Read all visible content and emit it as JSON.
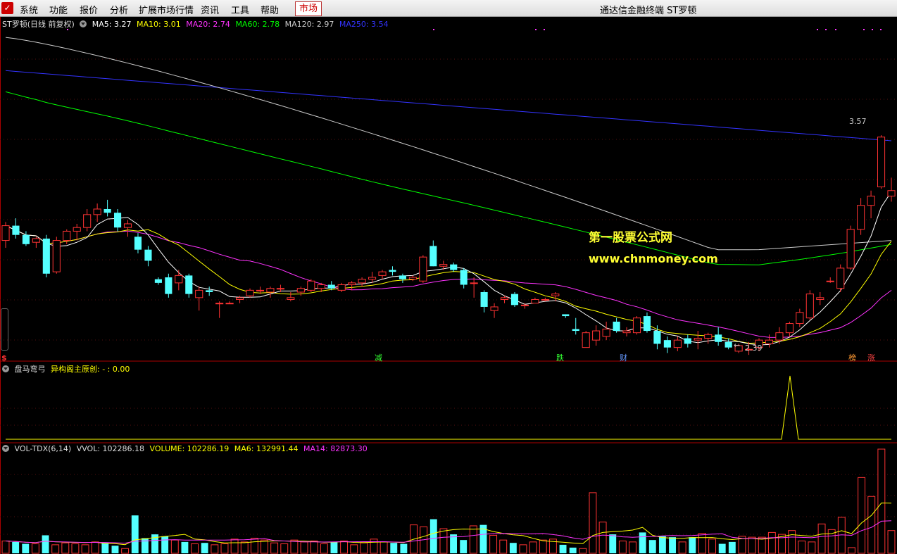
{
  "menu": {
    "items": [
      "系统",
      "功能",
      "报价",
      "分析",
      "扩展市场行情",
      "资讯",
      "工具",
      "帮助"
    ],
    "market_button": "市场",
    "window_title": "通达信金融终端  ST罗顿"
  },
  "main_panel": {
    "title": "ST罗顿(日线 前复权)",
    "ma": [
      {
        "label": "MA5: 3.27",
        "color": "#ffffff"
      },
      {
        "label": "MA10: 3.01",
        "color": "#ffff00"
      },
      {
        "label": "MA20: 2.74",
        "color": "#ff33ff"
      },
      {
        "label": "MA60: 2.78",
        "color": "#00ff00"
      },
      {
        "label": "MA120: 2.97",
        "color": "#cccccc"
      },
      {
        "label": "MA250: 3.54",
        "color": "#3333ff"
      }
    ],
    "high_label": "3.57",
    "low_label": "2.39",
    "events": [
      {
        "text": "减",
        "color": "#33ff33"
      },
      {
        "text": "跌",
        "color": "#33ff33"
      },
      {
        "text": "财",
        "color": "#6699ff"
      },
      {
        "text": "榜",
        "color": "#ff9933"
      },
      {
        "text": "涨",
        "color": "#ff4444"
      }
    ],
    "left_marker": "$"
  },
  "indicator_panel": {
    "title": "盘马弯弓",
    "formula_label": "异构阁主原创: - : 0.00"
  },
  "volume_panel": {
    "title": "VOL-TDX(6,14)",
    "vvol": "VVOL: 102286.18",
    "volume": "VOLUME: 102286.19",
    "ma6": "MA6: 132991.44",
    "ma14": "MA14: 82873.30"
  },
  "watermark": {
    "line1": "第一股票公式网",
    "line2": "www.chnmoney.com"
  },
  "colors": {
    "up": "#ff3333",
    "down": "#54ffff",
    "ma5": "#ffffff",
    "ma10": "#ffff00",
    "ma20": "#ff33ff",
    "ma60": "#00ff00",
    "ma120": "#cccccc",
    "ma250": "#3333ff",
    "panel_border": "#aa0000"
  },
  "chart_data": {
    "type": "candlestick",
    "price_range": [
      2.35,
      4.15
    ],
    "candles": [
      [
        3.0,
        3.1,
        2.96,
        3.08
      ],
      [
        3.08,
        3.12,
        3.01,
        3.03
      ],
      [
        3.03,
        3.05,
        2.97,
        2.98
      ],
      [
        2.99,
        3.02,
        2.96,
        3.01
      ],
      [
        3.01,
        3.03,
        2.8,
        2.82
      ],
      [
        2.83,
        3.02,
        2.82,
        3.0
      ],
      [
        3.0,
        3.06,
        2.98,
        3.05
      ],
      [
        3.05,
        3.09,
        3.0,
        3.07
      ],
      [
        3.07,
        3.17,
        3.05,
        3.14
      ],
      [
        3.14,
        3.2,
        3.1,
        3.17
      ],
      [
        3.17,
        3.22,
        3.13,
        3.15
      ],
      [
        3.15,
        3.17,
        3.05,
        3.07
      ],
      [
        3.07,
        3.11,
        3.02,
        3.09
      ],
      [
        3.02,
        3.04,
        2.93,
        2.95
      ],
      [
        2.95,
        2.97,
        2.86,
        2.89
      ],
      [
        2.79,
        2.8,
        2.76,
        2.77
      ],
      [
        2.8,
        2.82,
        2.69,
        2.71
      ],
      [
        2.77,
        2.84,
        2.73,
        2.81
      ],
      [
        2.81,
        2.82,
        2.69,
        2.71
      ],
      [
        2.69,
        2.75,
        2.62,
        2.73
      ],
      [
        2.73,
        2.75,
        2.7,
        2.72
      ],
      [
        2.66,
        2.67,
        2.58,
        2.66
      ],
      [
        2.66,
        2.67,
        2.66,
        2.66
      ],
      [
        2.68,
        2.7,
        2.66,
        2.69
      ],
      [
        2.7,
        2.74,
        2.69,
        2.73
      ],
      [
        2.73,
        2.75,
        2.71,
        2.73
      ],
      [
        2.72,
        2.75,
        2.69,
        2.74
      ],
      [
        2.74,
        2.76,
        2.72,
        2.74
      ],
      [
        2.68,
        2.72,
        2.67,
        2.69
      ],
      [
        2.72,
        2.75,
        2.7,
        2.74
      ],
      [
        2.73,
        2.79,
        2.72,
        2.78
      ],
      [
        2.74,
        2.77,
        2.72,
        2.76
      ],
      [
        2.76,
        2.78,
        2.73,
        2.74
      ],
      [
        2.73,
        2.77,
        2.72,
        2.76
      ],
      [
        2.76,
        2.78,
        2.73,
        2.77
      ],
      [
        2.77,
        2.8,
        2.75,
        2.79
      ],
      [
        2.79,
        2.83,
        2.77,
        2.8
      ],
      [
        2.81,
        2.84,
        2.79,
        2.83
      ],
      [
        2.84,
        2.86,
        2.81,
        2.83
      ],
      [
        2.81,
        2.82,
        2.77,
        2.79
      ],
      [
        2.79,
        2.81,
        2.78,
        2.8
      ],
      [
        2.78,
        2.92,
        2.77,
        2.91
      ],
      [
        2.97,
        3.0,
        2.86,
        2.86
      ],
      [
        2.86,
        2.89,
        2.84,
        2.87
      ],
      [
        2.87,
        2.88,
        2.83,
        2.84
      ],
      [
        2.84,
        2.85,
        2.74,
        2.76
      ],
      [
        2.77,
        2.8,
        2.69,
        2.77
      ],
      [
        2.72,
        2.73,
        2.61,
        2.64
      ],
      [
        2.62,
        2.66,
        2.58,
        2.64
      ],
      [
        2.68,
        2.7,
        2.66,
        2.69
      ],
      [
        2.71,
        2.72,
        2.64,
        2.65
      ],
      [
        2.65,
        2.66,
        2.63,
        2.65
      ],
      [
        2.66,
        2.69,
        2.66,
        2.68
      ],
      [
        2.68,
        2.69,
        2.67,
        2.68
      ],
      [
        2.7,
        2.72,
        2.67,
        2.71
      ],
      [
        2.6,
        2.6,
        2.58,
        2.59
      ],
      [
        2.52,
        2.58,
        2.49,
        2.51
      ],
      [
        2.42,
        2.51,
        2.42,
        2.5
      ],
      [
        2.46,
        2.54,
        2.43,
        2.51
      ],
      [
        2.48,
        2.56,
        2.46,
        2.52
      ],
      [
        2.56,
        2.58,
        2.5,
        2.51
      ],
      [
        2.5,
        2.53,
        2.48,
        2.51
      ],
      [
        2.5,
        2.59,
        2.49,
        2.58
      ],
      [
        2.59,
        2.61,
        2.5,
        2.51
      ],
      [
        2.51,
        2.54,
        2.41,
        2.44
      ],
      [
        2.46,
        2.48,
        2.39,
        2.42
      ],
      [
        2.42,
        2.48,
        2.4,
        2.46
      ],
      [
        2.47,
        2.49,
        2.42,
        2.44
      ],
      [
        2.46,
        2.51,
        2.41,
        2.47
      ],
      [
        2.47,
        2.5,
        2.44,
        2.49
      ],
      [
        2.49,
        2.53,
        2.43,
        2.45
      ],
      [
        2.45,
        2.47,
        2.41,
        2.42
      ],
      [
        2.4,
        2.44,
        2.39,
        2.43
      ],
      [
        2.41,
        2.45,
        2.38,
        2.41
      ],
      [
        2.42,
        2.47,
        2.4,
        2.46
      ],
      [
        2.44,
        2.49,
        2.42,
        2.46
      ],
      [
        2.46,
        2.53,
        2.44,
        2.5
      ],
      [
        2.5,
        2.56,
        2.48,
        2.55
      ],
      [
        2.55,
        2.63,
        2.53,
        2.61
      ],
      [
        2.58,
        2.73,
        2.57,
        2.71
      ],
      [
        2.68,
        2.72,
        2.65,
        2.69
      ],
      [
        2.78,
        2.8,
        2.77,
        2.78
      ],
      [
        2.74,
        2.87,
        2.72,
        2.85
      ],
      [
        2.85,
        3.08,
        2.84,
        3.06
      ],
      [
        3.06,
        3.23,
        3.03,
        3.19
      ],
      [
        3.19,
        3.27,
        3.12,
        3.24
      ],
      [
        3.29,
        3.57,
        3.28,
        3.56
      ],
      [
        3.24,
        3.34,
        3.21,
        3.27
      ]
    ],
    "indicator_series": [
      0,
      0,
      0,
      0,
      0,
      0,
      0,
      0,
      0,
      0,
      0,
      0,
      0,
      0,
      0,
      0,
      0,
      0,
      0,
      0,
      0,
      0,
      0,
      0,
      0,
      0,
      0,
      0,
      0,
      0,
      0,
      0,
      0,
      0,
      0,
      0,
      0,
      0,
      0,
      0,
      0,
      0,
      0,
      0,
      0,
      0,
      0,
      0,
      0,
      0,
      0,
      0,
      0,
      0,
      0,
      0,
      0,
      0,
      0,
      0,
      0,
      0,
      0,
      0,
      0,
      0,
      0,
      0,
      0,
      0,
      0,
      0,
      0,
      0,
      0,
      0,
      0,
      0,
      0,
      0,
      0,
      0,
      0,
      0,
      0,
      0,
      0,
      0,
      1
    ],
    "volume": [
      13,
      12,
      10,
      10,
      19,
      9,
      11,
      10,
      9,
      12,
      11,
      8,
      5,
      40,
      16,
      20,
      18,
      14,
      12,
      10,
      11,
      9,
      10,
      15,
      12,
      16,
      14,
      11,
      10,
      14,
      12,
      13,
      10,
      12,
      13,
      9,
      11,
      15,
      12,
      11,
      10,
      30,
      28,
      36,
      26,
      20,
      14,
      29,
      30,
      19,
      14,
      11,
      9,
      12,
      14,
      15,
      9,
      6,
      5,
      64,
      33,
      20,
      13,
      12,
      22,
      14,
      18,
      17,
      12,
      17,
      21,
      15,
      10,
      12,
      18,
      17,
      17,
      22,
      20,
      24,
      13,
      12,
      31,
      25,
      38,
      6,
      80,
      60,
      110,
      24
    ],
    "ma6_vol": [],
    "ma14_vol": []
  }
}
